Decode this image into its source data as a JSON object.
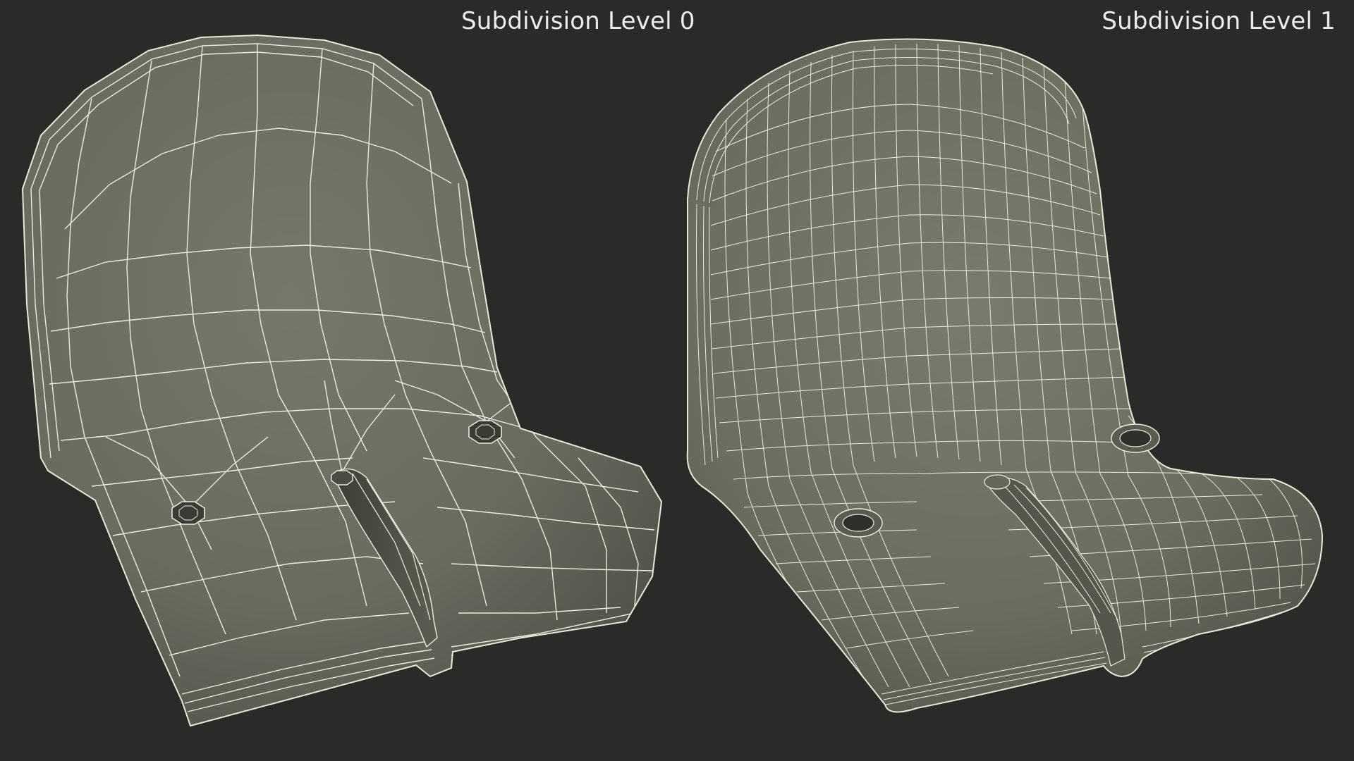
{
  "panels": {
    "left": {
      "title": "Subdivision Level 0"
    },
    "right": {
      "title": "Subdivision Level 1"
    }
  },
  "colors": {
    "background": "#2a2a29",
    "shell": "#6f7064",
    "wire": "#ecebdc",
    "title_text": "#ececec"
  }
}
